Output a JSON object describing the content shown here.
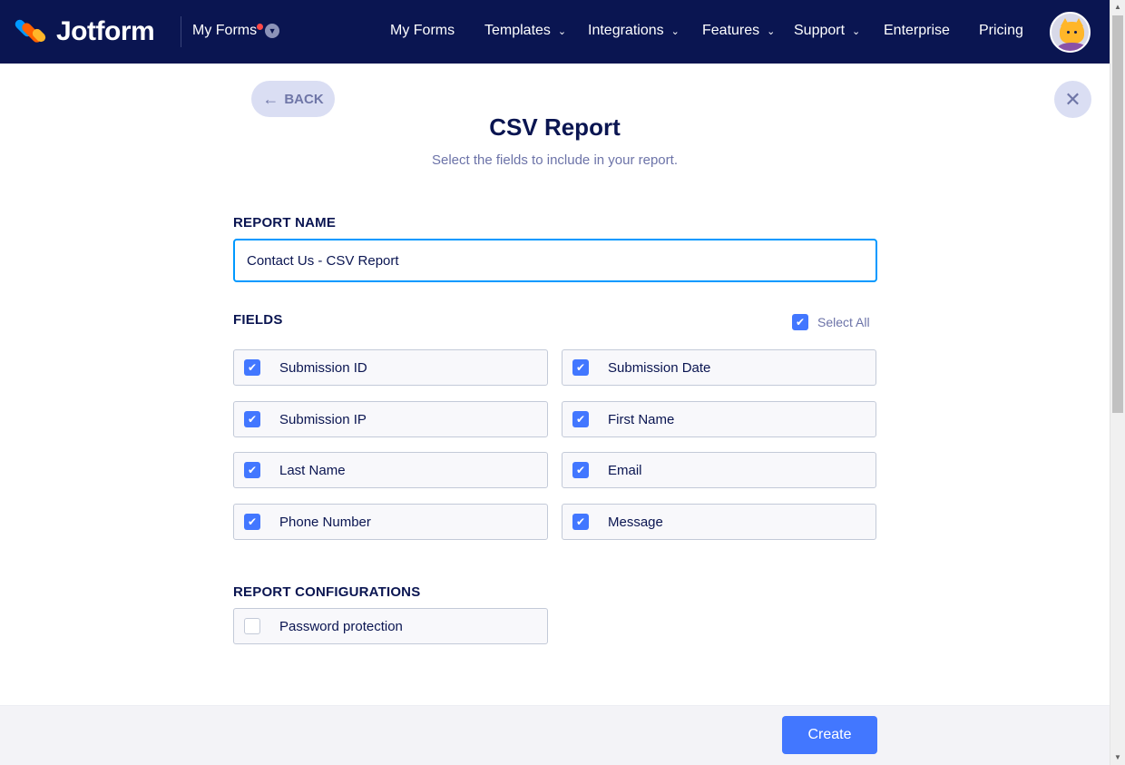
{
  "brand": {
    "name": "Jotform"
  },
  "topnav": {
    "myforms_dropdown": "My Forms",
    "items": [
      {
        "label": "My Forms",
        "has_caret": false
      },
      {
        "label": "Templates",
        "has_caret": true
      },
      {
        "label": "Integrations",
        "has_caret": true
      },
      {
        "label": "Features",
        "has_caret": true
      },
      {
        "label": "Support",
        "has_caret": true
      },
      {
        "label": "Enterprise",
        "has_caret": false
      },
      {
        "label": "Pricing",
        "has_caret": false
      }
    ]
  },
  "page": {
    "back_label": "BACK",
    "title": "CSV Report",
    "subtitle": "Select the fields to include in your report."
  },
  "report_name": {
    "label": "REPORT NAME",
    "value": "Contact Us - CSV Report"
  },
  "fields": {
    "label": "FIELDS",
    "select_all_label": "Select All",
    "select_all_checked": true,
    "items": [
      {
        "label": "Submission ID",
        "checked": true
      },
      {
        "label": "Submission Date",
        "checked": true
      },
      {
        "label": "Submission IP",
        "checked": true
      },
      {
        "label": "First Name",
        "checked": true
      },
      {
        "label": "Last Name",
        "checked": true
      },
      {
        "label": "Email",
        "checked": true
      },
      {
        "label": "Phone Number",
        "checked": true
      },
      {
        "label": "Message",
        "checked": true
      }
    ]
  },
  "configurations": {
    "label": "REPORT CONFIGURATIONS",
    "items": [
      {
        "label": "Password protection",
        "checked": false
      }
    ]
  },
  "footer": {
    "create_label": "Create"
  },
  "colors": {
    "nav_bg": "#0a1551",
    "accent": "#4277ff",
    "input_focus": "#0099ff",
    "text_primary": "#0a1551",
    "text_muted": "#6c73a8"
  }
}
